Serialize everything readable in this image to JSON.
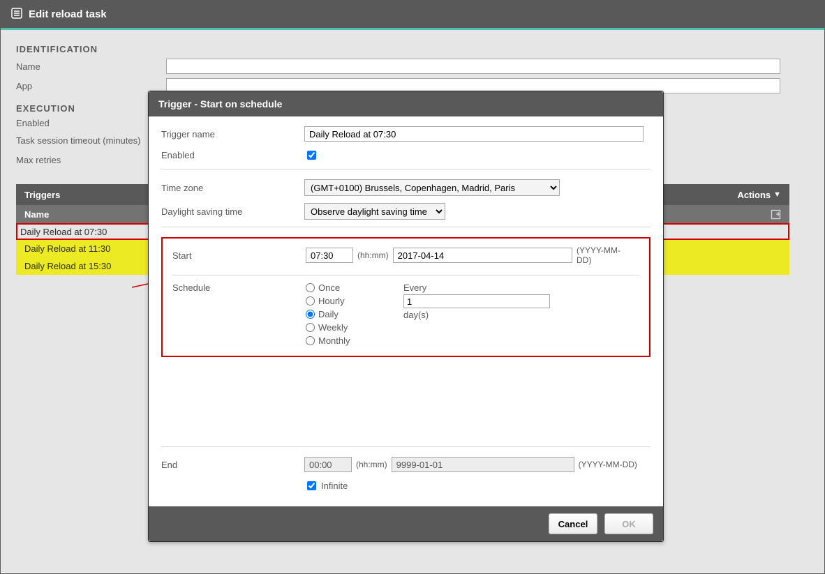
{
  "header": {
    "title": "Edit reload task"
  },
  "identification": {
    "heading": "IDENTIFICATION",
    "name_label": "Name",
    "app_label": "App"
  },
  "execution": {
    "heading": "EXECUTION",
    "enabled_label": "Enabled",
    "timeout_label": "Task session timeout (minutes)",
    "retries_label": "Max retries"
  },
  "triggers": {
    "bar_title": "Triggers",
    "actions_label": "Actions",
    "name_col": "Name",
    "rows": [
      {
        "label": "Daily Reload at 07:30",
        "selected": true,
        "highlight": false
      },
      {
        "label": "Daily Reload at 11:30",
        "selected": false,
        "highlight": true
      },
      {
        "label": "Daily Reload at 15:30",
        "selected": false,
        "highlight": true
      }
    ]
  },
  "modal": {
    "title": "Trigger - Start on schedule",
    "trigger_name_label": "Trigger name",
    "trigger_name_value": "Daily Reload at 07:30",
    "enabled_label": "Enabled",
    "enabled_checked": true,
    "timezone_label": "Time zone",
    "timezone_value": "(GMT+0100) Brussels, Copenhagen, Madrid, Paris",
    "dst_label": "Daylight saving time",
    "dst_value": "Observe daylight saving time",
    "start_label": "Start",
    "start_time": "07:30",
    "start_date": "2017-04-14",
    "hhmm_hint": "(hh:mm)",
    "ymd_hint": "(YYYY-MM-DD)",
    "schedule_label": "Schedule",
    "schedule_options": {
      "once": "Once",
      "hourly": "Hourly",
      "daily": "Daily",
      "weekly": "Weekly",
      "monthly": "Monthly"
    },
    "schedule_selected": "daily",
    "every_label": "Every",
    "every_value": "1",
    "every_unit": "day(s)",
    "end_label": "End",
    "end_time": "00:00",
    "end_date": "9999-01-01",
    "infinite_label": "Infinite",
    "infinite_checked": true,
    "cancel_label": "Cancel",
    "ok_label": "OK"
  }
}
